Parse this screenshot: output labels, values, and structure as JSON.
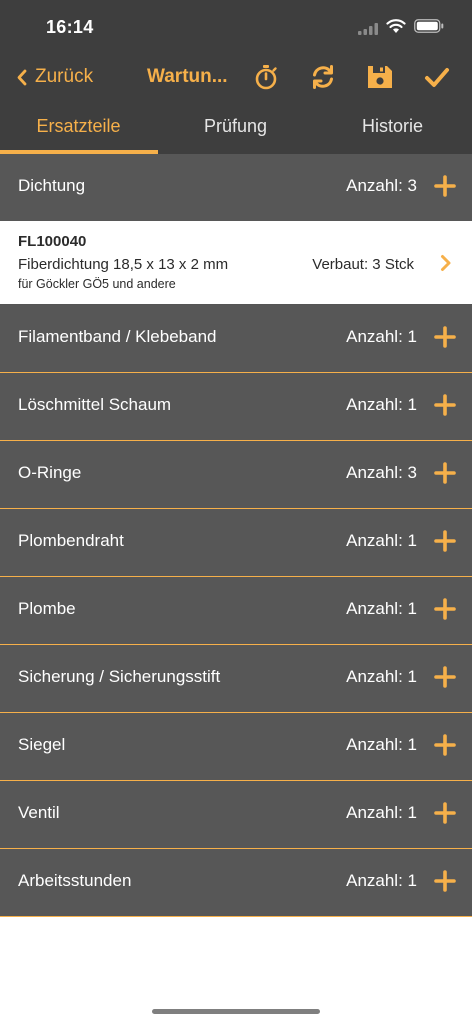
{
  "status": {
    "time": "16:14"
  },
  "nav": {
    "back_label": "Zurück",
    "title": "Wartun...",
    "actions": [
      "stopwatch-icon",
      "refresh-icon",
      "save-icon",
      "checkmark-icon"
    ]
  },
  "tabs": [
    "Ersatzteile",
    "Prüfung",
    "Historie"
  ],
  "active_tab": "Ersatzteile",
  "groups": [
    {
      "name": "Dichtung",
      "count": "Anzahl: 3"
    },
    {
      "name": "Filamentband / Klebeband",
      "count": "Anzahl: 1"
    },
    {
      "name": "Löschmittel Schaum",
      "count": "Anzahl: 1"
    },
    {
      "name": "O-Ringe",
      "count": "Anzahl: 3"
    },
    {
      "name": "Plombendraht",
      "count": "Anzahl: 1"
    },
    {
      "name": "Plombe",
      "count": "Anzahl: 1"
    },
    {
      "name": "Sicherung / Sicherungsstift",
      "count": "Anzahl: 1"
    },
    {
      "name": "Siegel",
      "count": "Anzahl: 1"
    },
    {
      "name": "Ventil",
      "count": "Anzahl: 1"
    },
    {
      "name": "Arbeitsstunden",
      "count": "Anzahl: 1"
    }
  ],
  "expanded_part": {
    "code": "FL100040",
    "description": "Fiberdichtung 18,5 x 13 x 2 mm",
    "subtitle": "für Göckler GÖ5 und andere",
    "installed": "Verbaut: 3 Stck"
  },
  "colors": {
    "accent": "#f6b04a",
    "header_bg": "#3e3e3e",
    "row_bg": "#575757",
    "white": "#ffffff"
  }
}
